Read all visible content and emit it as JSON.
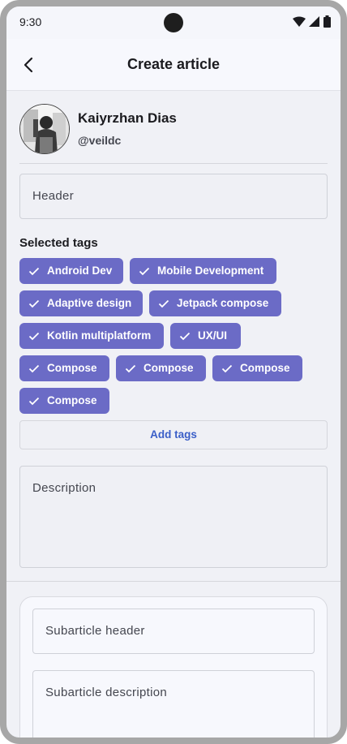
{
  "status_bar": {
    "time": "9:30"
  },
  "app_bar": {
    "title": "Create article"
  },
  "profile": {
    "name": "Kaiyrzhan Dias",
    "handle": "@veildc"
  },
  "form": {
    "header_placeholder": "Header",
    "selected_tags_label": "Selected tags",
    "tags": [
      "Android Dev",
      "Mobile Development",
      "Adaptive design",
      "Jetpack compose",
      "Kotlin multiplatform",
      "UX/UI",
      "Compose",
      "Compose",
      "Compose",
      "Compose"
    ],
    "add_tags_label": "Add tags",
    "description_placeholder": "Description"
  },
  "subarticle": {
    "header_placeholder": "Subarticle header",
    "description_placeholder": "Subarticle description"
  },
  "colors": {
    "chip": "#6b6bc6",
    "accent_text": "#3b5fc8",
    "background": "#f0f1f6"
  }
}
